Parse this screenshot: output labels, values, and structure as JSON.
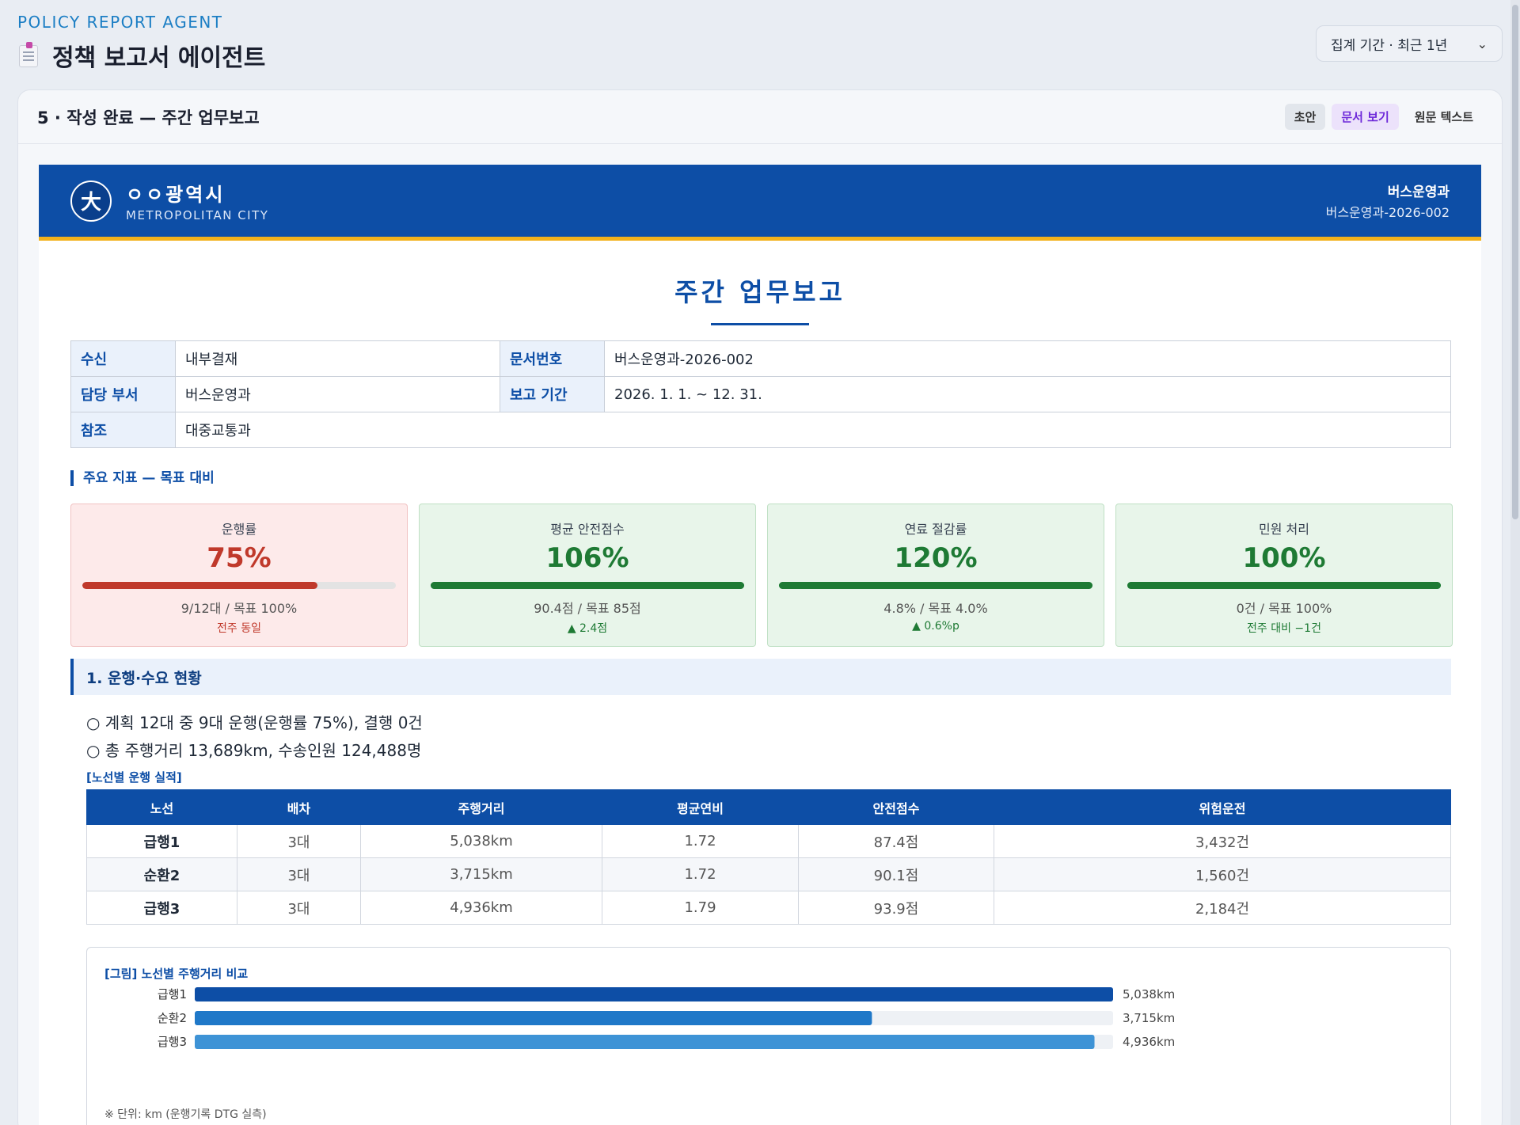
{
  "app": {
    "eyebrow": "POLICY REPORT AGENT",
    "title": "정책 보고서 에이전트",
    "period_select": "집계 기간 · 최근 1년"
  },
  "panel": {
    "title": "5 · 작성 완료 — 주간 업무보고",
    "tabs": [
      "초안",
      "문서 보기",
      "원문 텍스트"
    ],
    "active_tab": "문서 보기"
  },
  "banner": {
    "emblem": "大",
    "city": "ㅇㅇ광역시",
    "city_sub": "METROPOLITAN CITY",
    "dept": "버스운영과",
    "doc_code": "버스운영과-2026-002"
  },
  "report": {
    "title": "주간 업무보고",
    "meta": {
      "recipient_label": "수신",
      "recipient": "내부결재",
      "docno_label": "문서번호",
      "docno": "버스운영과-2026-002",
      "dept_label": "담당 부서",
      "dept": "버스운영과",
      "period_label": "보고 기간",
      "period": "2026. 1. 1. ~ 12. 31.",
      "ref_label": "참조",
      "ref": "대중교통과"
    },
    "kpi_section": "주요 지표 — 목표 대비",
    "kpis": [
      {
        "label": "운행률",
        "value": "75%",
        "progress": 75,
        "sub": "9/12대 / 목표 100%",
        "delta": "전주 동일",
        "status": "red"
      },
      {
        "label": "평균 안전점수",
        "value": "106%",
        "progress": 100,
        "sub": "90.4점 / 목표 85점",
        "delta": "▲ 2.4점",
        "status": "green"
      },
      {
        "label": "연료 절감률",
        "value": "120%",
        "progress": 100,
        "sub": "4.8% / 목표 4.0%",
        "delta": "▲ 0.6%p",
        "status": "green"
      },
      {
        "label": "민원 처리",
        "value": "100%",
        "progress": 100,
        "sub": "0건 / 목표 100%",
        "delta": "전주 대비 −1건",
        "status": "green"
      }
    ],
    "section1": {
      "title": "1. 운행·수요 현황",
      "bullets": [
        "○ 계획 12대 중 9대 운행(운행률 75%), 결행 0건",
        "○ 총 주행거리 13,689km, 수송인원 124,488명"
      ],
      "table_caption": "[노선별 운행 실적]",
      "table_headers": [
        "노선",
        "배차",
        "주행거리",
        "평균연비",
        "안전점수",
        "위험운전"
      ],
      "table_rows": [
        [
          "급행1",
          "3대",
          "5,038km",
          "1.72",
          "87.4점",
          "3,432건"
        ],
        [
          "순환2",
          "3대",
          "3,715km",
          "1.72",
          "90.1점",
          "1,560건"
        ],
        [
          "급행3",
          "3대",
          "4,936km",
          "1.79",
          "93.9점",
          "2,184건"
        ]
      ]
    }
  },
  "chart_data": {
    "type": "bar",
    "orientation": "horizontal",
    "title": "[그림] 노선별 주행거리 비교",
    "categories": [
      "급행1",
      "순환2",
      "급행3"
    ],
    "values": [
      5038,
      3715,
      4936
    ],
    "value_labels": [
      "5,038km",
      "3,715km",
      "4,936km"
    ],
    "xlim": [
      0,
      5038
    ],
    "colors": [
      "#0d4ea6",
      "#1f78c8",
      "#3e93d6"
    ],
    "track_color": "#eef1f5",
    "note": "※ 단위: km (운행기록 DTG 실측)"
  }
}
